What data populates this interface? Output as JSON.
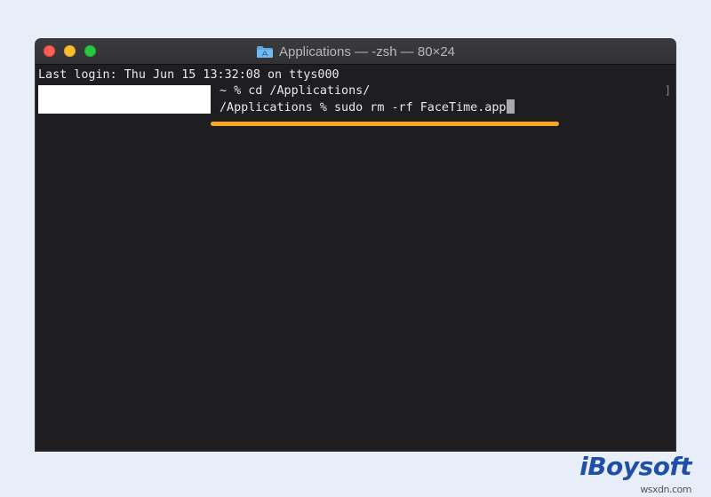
{
  "window": {
    "title": "Applications — -zsh — 80×24"
  },
  "terminal": {
    "line1": "Last login: Thu Jun 15 13:32:08 on ttys000",
    "line2": "~ % cd /Applications/",
    "line3": "/Applications % sudo rm -rf FaceTime.app",
    "scroll_glyph": "]"
  },
  "watermark": {
    "brand": "iBoysoft",
    "site": "wsxdn.com"
  },
  "colors": {
    "highlight": "#f5a623",
    "close": "#ff5f57",
    "minimize": "#febc2e",
    "maximize": "#28c840"
  }
}
